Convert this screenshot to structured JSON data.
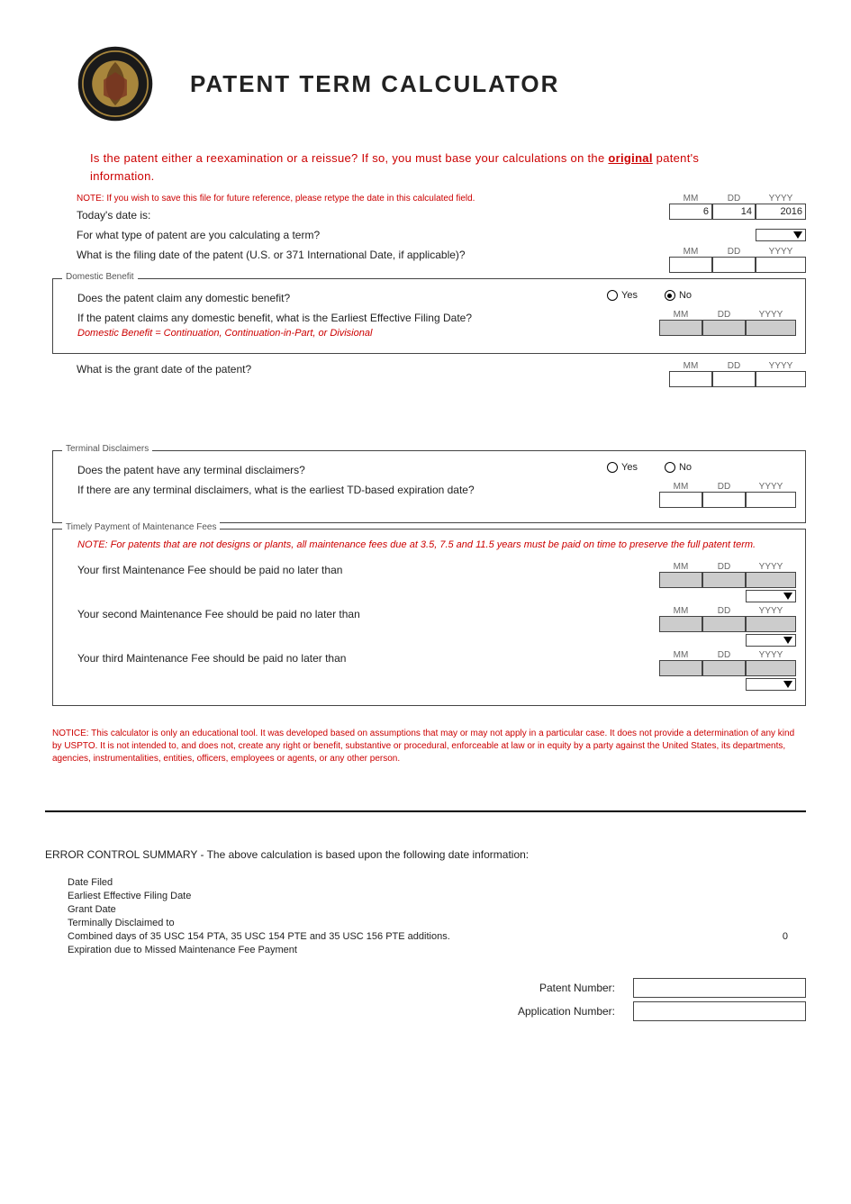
{
  "title": "PATENT TERM CALCULATOR",
  "warning": {
    "text1": "Is the patent either a reexamination or a reissue?  If so, you must  base your calculations on the ",
    "original_word": "original",
    "text2": " patent's information."
  },
  "note_save": "NOTE:  If you wish to save this file for future reference, please retype the date in this calculated field.",
  "headers": {
    "mm": "MM",
    "dd": "DD",
    "yyyy": "YYYY"
  },
  "today_label": "Today's date is:",
  "today": {
    "mm": "6",
    "dd": "14",
    "yyyy": "2016"
  },
  "type_label": "For what type of patent are you calculating a term?",
  "filing_label": "What is the filing date of the patent (U.S. or 371 International Date, if applicable)?",
  "domestic_benefit": {
    "legend": "Domestic Benefit",
    "claim_label": "Does the patent claim any domestic benefit?",
    "yes": "Yes",
    "no": "No",
    "selected": "no",
    "eff_label": "If the patent claims any domestic benefit, what is the Earliest Effective Filing Date?",
    "eff_sub": "Domestic Benefit = Continuation, Continuation-in-Part, or Divisional"
  },
  "grant_label": "What is the grant date of the patent?",
  "terminal": {
    "legend": "Terminal Disclaimers",
    "q_label": "Does the patent have any terminal disclaimers?",
    "yes": "Yes",
    "no": "No",
    "td_label": "If there are any terminal disclaimers, what is the earliest TD-based expiration date?"
  },
  "maintenance": {
    "legend": "Timely Payment of Maintenance Fees",
    "note": "NOTE:   For patents that are not designs or plants, all maintenance fees due at 3.5, 7.5 and 11.5 years must be paid on time to preserve the full patent term.",
    "first": "Your first Maintenance Fee should be paid no later than",
    "second": "Your second Maintenance Fee should be paid no later than",
    "third": "Your third Maintenance Fee should be paid no later than"
  },
  "notice": "NOTICE:  This calculator is only an educational tool. It was developed based on assumptions that may or may not apply in a particular case.  It does not provide a determination of any kind by USPTO. It is not intended to, and does not, create any right or benefit, substantive or procedural, enforceable at law or in equity by a party against the United States, its departments, agencies, instrumentalities, entities, officers, employees or agents, or any other person.",
  "error_title": "ERROR CONTROL SUMMARY - The above calculation is based upon the following date information:",
  "summary": {
    "date_filed": "Date Filed",
    "eff_date": "Earliest Effective Filing Date",
    "grant_date": "Grant Date",
    "term_disc": "Terminally Disclaimed to",
    "combined": "Combined days of 35 USC 154 PTA, 35 USC 154 PTE and 35 USC 156 PTE additions.",
    "combined_value": "0",
    "expire": "Expiration due to Missed Maintenance Fee Payment"
  },
  "patent_number_label": "Patent Number:",
  "app_number_label": "Application Number:"
}
